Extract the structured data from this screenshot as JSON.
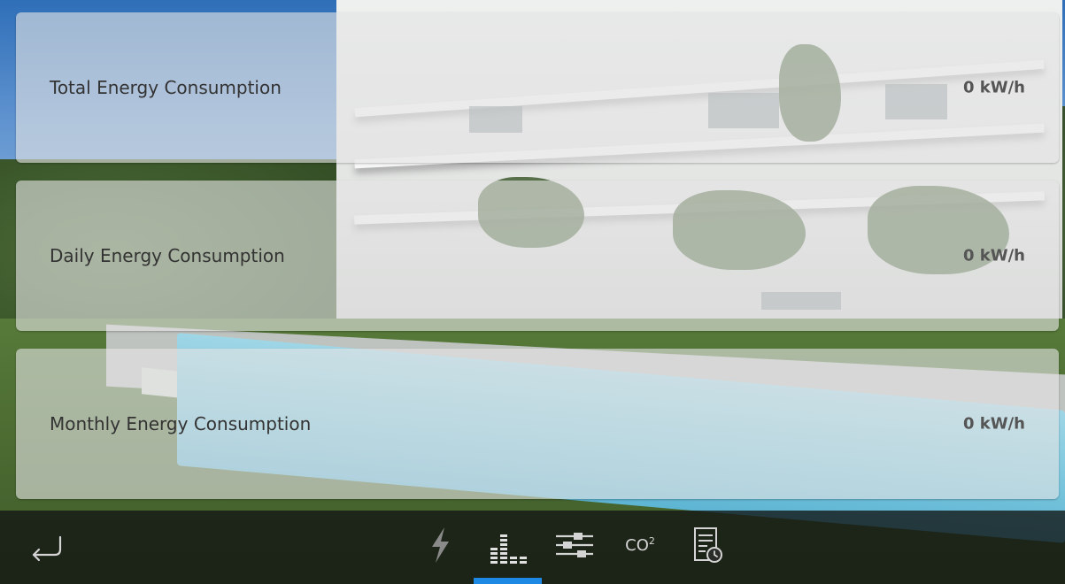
{
  "cards": [
    {
      "label": "Total Energy Consumption",
      "value": "0 kW/h"
    },
    {
      "label": "Daily Energy Consumption",
      "value": "0 kW/h"
    },
    {
      "label": "Monthly Energy Consumption",
      "value": "0 kW/h"
    }
  ],
  "bottom_nav": {
    "back_icon": "return-arrow-icon",
    "items": [
      {
        "icon": "lightning-icon",
        "active": false
      },
      {
        "icon": "bar-chart-icon",
        "active": true
      },
      {
        "icon": "sliders-icon",
        "active": false
      },
      {
        "icon": "co2-icon",
        "label": "CO",
        "label_sup": "2",
        "active": false
      },
      {
        "icon": "report-clock-icon",
        "active": false
      }
    ]
  },
  "colors": {
    "accent": "#1e88e5",
    "card_bg": "rgba(228,228,228,0.62)",
    "bar_bg": "rgba(18,20,18,0.78)",
    "icon": "#d4d4d4",
    "icon_dim": "#8a8a8a"
  }
}
